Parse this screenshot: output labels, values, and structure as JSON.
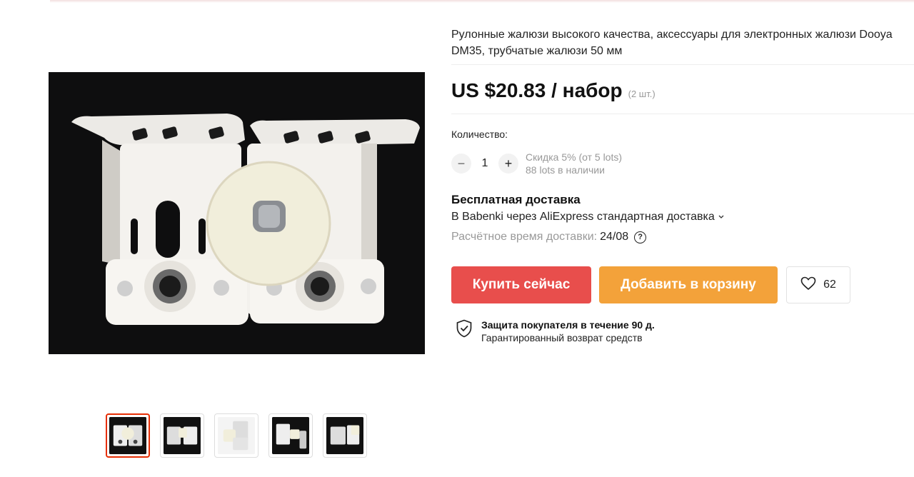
{
  "product": {
    "title": "Рулонные жалюзи высокого качества, аксессуары для электронных жалюзи Dooya DM35, трубчатые жалюзи 50 мм",
    "price": "US $20.83 / набор",
    "price_unit": "(2 шт.)",
    "main_image": "white-roller-blind-brackets-with-bearings",
    "thumbnails": [
      {
        "icon": "thumbnail-brackets-front",
        "active": true
      },
      {
        "icon": "thumbnail-brackets-angle",
        "active": false
      },
      {
        "icon": "thumbnail-brackets-side",
        "active": false
      },
      {
        "icon": "thumbnail-brackets-set",
        "active": false
      },
      {
        "icon": "thumbnail-brackets-detail",
        "active": false
      }
    ]
  },
  "quantity": {
    "label": "Количество:",
    "minus_icon": "minus-icon",
    "value": "1",
    "plus_icon": "plus-icon",
    "discount": "Скидка 5% (от 5 lots)",
    "stock": "88 lots в наличии"
  },
  "shipping": {
    "title": "Бесплатная доставка",
    "via": "В Babenki через AliExpress стандартная доставка",
    "eta_label": "Расчётное время доставки:",
    "eta_date": "24/08",
    "help_icon": "question-circle-icon"
  },
  "actions": {
    "buy_now": "Купить сейчас",
    "add_to_cart": "Добавить в корзину",
    "wishlist_count": "62",
    "wishlist_icon": "heart-icon"
  },
  "protection": {
    "title": "Защита покупателя в течение 90 д.",
    "subtitle": "Гарантированный возврат средств",
    "icon": "shield-check-icon"
  },
  "colors": {
    "buy_button": "#e84e4c",
    "cart_button": "#f3a23a",
    "active_thumb_border": "#e62e04"
  }
}
